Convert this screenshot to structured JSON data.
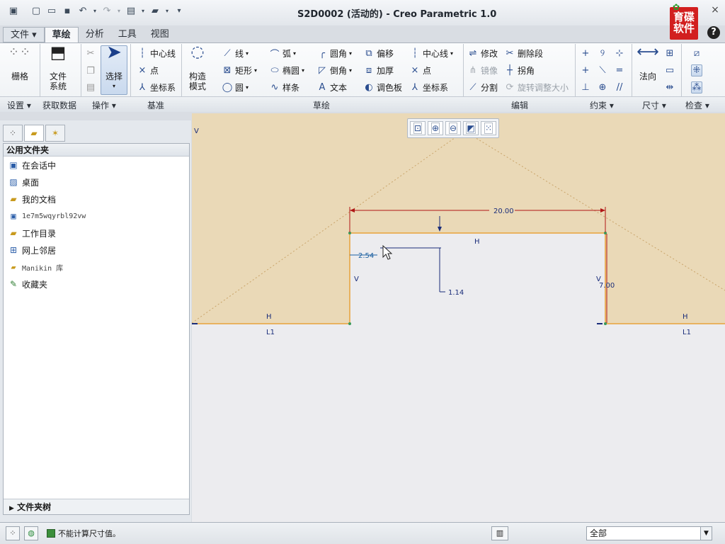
{
  "window": {
    "title": "S2D0002 (活动的) - Creo Parametric 1.0",
    "logo_text": "育碟软件",
    "help_label": "?"
  },
  "tabs": [
    {
      "label": "文件 ▾"
    },
    {
      "label": "草绘"
    },
    {
      "label": "分析"
    },
    {
      "label": "工具"
    },
    {
      "label": "视图"
    }
  ],
  "ribbon": {
    "setup": {
      "grid": "栅格"
    },
    "get_data": {
      "file_system": "文件系统"
    },
    "operations": {
      "select": "选择"
    },
    "datum": {
      "centerline": "中心线",
      "point": "点",
      "coord_sys": "坐标系"
    },
    "construction": {
      "mode": "构造模式"
    },
    "sketch": {
      "line": "线",
      "arc": "弧",
      "fillet": "圆角",
      "offset": "偏移",
      "centerline": "中心线",
      "rectangle": "矩形",
      "ellipse": "椭圆",
      "chamfer": "倒角",
      "thicken": "加厚",
      "point": "点",
      "circle": "圆",
      "spline": "样条",
      "text": "文本",
      "palette": "调色板",
      "coord_sys": "坐标系"
    },
    "edit": {
      "modify": "修改",
      "delete_segment": "删除段",
      "mirror": "镜像",
      "corner": "拐角",
      "divide": "分割",
      "rotate_resize": "旋转调整大小"
    },
    "dimension": {
      "normal": "法向"
    },
    "groups": {
      "setup": "设置 ▾",
      "get_data": "获取数据",
      "operations": "操作 ▾",
      "datum": "基准",
      "sketch": "草绘",
      "edit": "编辑",
      "constrain": "约束 ▾",
      "dimension": "尺寸 ▾",
      "inspect": "检查 ▾"
    }
  },
  "left_panel": {
    "header": "公用文件夹",
    "items": [
      {
        "label": "在会话中",
        "icon": "session-icon"
      },
      {
        "label": "桌面",
        "icon": "desktop-icon"
      },
      {
        "label": "我的文档",
        "icon": "documents-icon"
      },
      {
        "label": "1e7m5wqyrbl92vw",
        "icon": "computer-icon"
      },
      {
        "label": "工作目录",
        "icon": "working-dir-icon"
      },
      {
        "label": "网上邻居",
        "icon": "network-icon"
      },
      {
        "label": "Manikin 库",
        "icon": "library-icon"
      },
      {
        "label": "收藏夹",
        "icon": "favorites-icon"
      }
    ],
    "footer": "文件夹树"
  },
  "sketch": {
    "dim_width": "20.00",
    "dim_height": "7.00",
    "dim_x": "2.54",
    "dim_y": "1.14",
    "c_H_top": "H",
    "c_V_left": "V",
    "c_V_right": "V",
    "c_H_left": "H",
    "c_H_right": "H",
    "c_L1_left": "L1",
    "c_L1_right": "L1",
    "c_V_corner": "V"
  },
  "status": {
    "message": "不能计算尺寸值。",
    "filter_value": "全部"
  },
  "colors": {
    "sketch_line": "#e8a23a",
    "dimension": "#b01515",
    "fill": "#ead9b7"
  }
}
